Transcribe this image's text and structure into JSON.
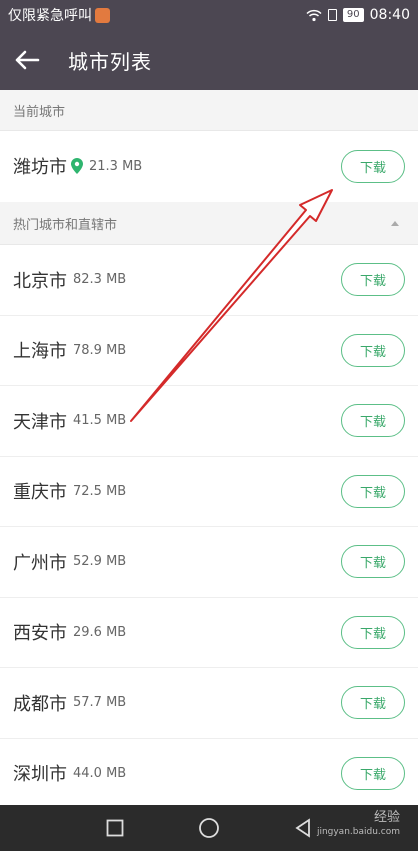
{
  "status_bar": {
    "left_text": "仅限紧急呼叫",
    "battery": "90",
    "time": "08:40"
  },
  "app_bar": {
    "title": "城市列表"
  },
  "current_section": {
    "label": "当前城市",
    "city": {
      "name": "潍坊市",
      "size": "21.3 MB",
      "button": "下载"
    }
  },
  "hot_section": {
    "label": "热门城市和直辖市",
    "cities": [
      {
        "name": "北京市",
        "size": "82.3 MB",
        "button": "下载"
      },
      {
        "name": "上海市",
        "size": "78.9 MB",
        "button": "下载"
      },
      {
        "name": "天津市",
        "size": "41.5 MB",
        "button": "下载"
      },
      {
        "name": "重庆市",
        "size": "72.5 MB",
        "button": "下载"
      },
      {
        "name": "广州市",
        "size": "52.9 MB",
        "button": "下载"
      },
      {
        "name": "西安市",
        "size": "29.6 MB",
        "button": "下载"
      },
      {
        "name": "成都市",
        "size": "57.7 MB",
        "button": "下载"
      },
      {
        "name": "深圳市",
        "size": "44.0 MB",
        "button": "下载"
      }
    ]
  },
  "watermark": {
    "brand": "经验",
    "url": "jingyan.baidu.com"
  },
  "colors": {
    "header": "#4c4752",
    "accent_green": "#3aa86a",
    "annotation_red": "#d42a2a"
  }
}
